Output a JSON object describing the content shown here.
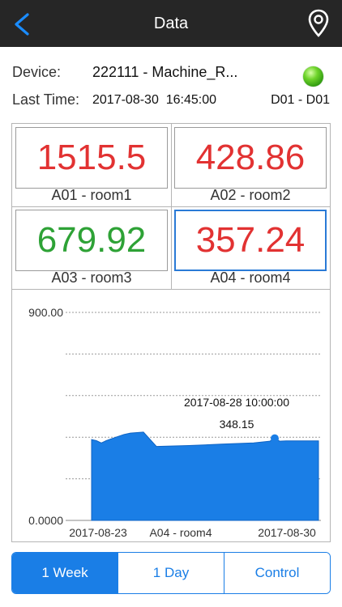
{
  "nav": {
    "title": "Data",
    "back_icon": "chevron-left-icon",
    "location_icon": "map-pin-icon"
  },
  "info": {
    "device_label": "Device:",
    "device_value": "222111 - Machine_R...",
    "last_time_label": "Last Time:",
    "last_time_value": "2017-08-30  16:45:00",
    "channel_range": "D01 - D01",
    "status_color": "#4CC61E"
  },
  "tiles": [
    {
      "value": "1515.5",
      "caption": "A01 - room1",
      "color": "#E23232",
      "selected": false
    },
    {
      "value": "428.86",
      "caption": "A02 - room2",
      "color": "#E23232",
      "selected": false
    },
    {
      "value": "679.92",
      "caption": "A03 - room3",
      "color": "#2EA236",
      "selected": false
    },
    {
      "value": "357.24",
      "caption": "A04 - room4",
      "color": "#E23232",
      "selected": true
    }
  ],
  "chart_data": {
    "type": "area",
    "series_name": "A04 - room4",
    "y_ticks": [
      "900.00",
      "0.0000"
    ],
    "ylim": [
      0,
      900
    ],
    "grid": true,
    "x_labels": [
      "2017-08-23",
      "A04 - room4",
      "2017-08-30"
    ],
    "x": [
      0,
      0.15,
      0.3,
      0.45,
      0.75,
      1.0,
      1.2,
      1.6,
      2.0,
      3.0,
      4.0,
      5.0,
      5.5,
      5.65,
      5.8,
      6.0,
      7.0
    ],
    "values": [
      350,
      345,
      335,
      345,
      360,
      372,
      378,
      382,
      320,
      324,
      330,
      335,
      343,
      355,
      343,
      344,
      344
    ],
    "fill_color": "#1A7EE6",
    "marker": {
      "label_time": "2017-08-28 10:00:00",
      "label_value": "348.15"
    }
  },
  "segments": [
    {
      "label": "1 Week",
      "active": true
    },
    {
      "label": "1 Day",
      "active": false
    },
    {
      "label": "Control",
      "active": false
    }
  ],
  "colors": {
    "accent": "#1A7EE6",
    "nav_bg": "#262626"
  }
}
